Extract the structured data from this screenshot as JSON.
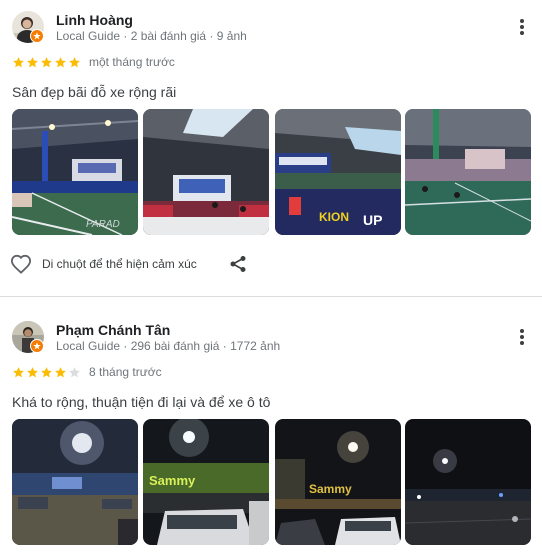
{
  "reviews": [
    {
      "author": "Linh Hoàng",
      "meta": "Local Guide · 2 bài đánh giá · 9 ảnh",
      "rating": 5,
      "date": "một tháng trước",
      "text": "Sân đẹp bãi đỗ xe rộng rãi",
      "photos": [
        "pickleball-court-night-photo",
        "event-stage-photo",
        "sponsor-banner-court-photo",
        "tennis-court-crowd-photo"
      ],
      "like_label": "Di chuột để thể hiện cảm xúc"
    },
    {
      "author": "Phạm Chánh Tân",
      "meta": "Local Guide · 296 bài đánh giá · 1772 ảnh",
      "rating": 4,
      "date": "8 tháng trước",
      "text": "Khá to rộng, thuận tiện đi lại và để xe ô tô",
      "photos": [
        "parking-lot-night-photo",
        "sammy-sign-parking-photo",
        "sammy-sign-street-photo",
        "dark-street-night-photo"
      ]
    }
  ],
  "colors": {
    "star_filled": "#fbbc04",
    "star_empty": "#dadce0",
    "badge": "#f57c00",
    "meta_text": "#70757a"
  }
}
